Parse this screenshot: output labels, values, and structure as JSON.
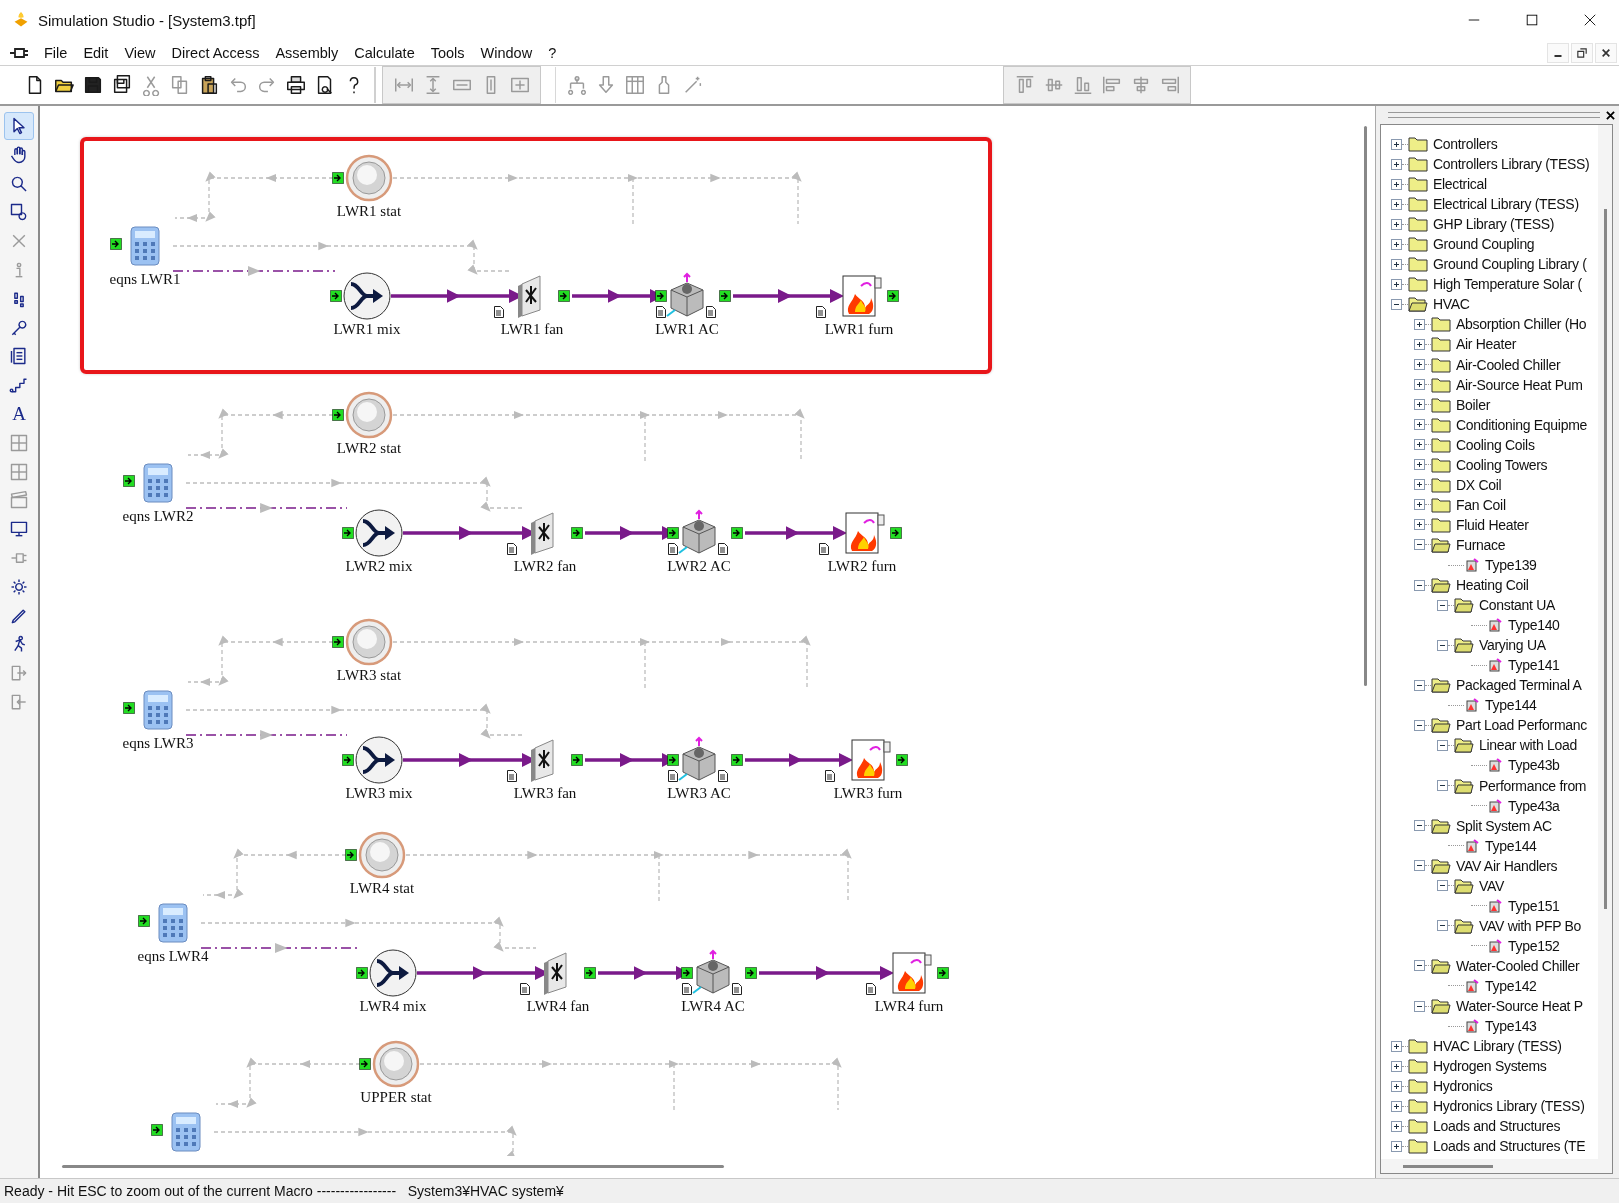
{
  "window": {
    "title": "Simulation Studio - [System3.tpf]"
  },
  "menu": [
    "File",
    "Edit",
    "View",
    "Direct Access",
    "Assembly",
    "Calculate",
    "Tools",
    "Window",
    "?"
  ],
  "toolbar": [
    [
      {
        "kind": "new",
        "disabled": false
      },
      {
        "kind": "open",
        "disabled": false
      },
      {
        "kind": "save",
        "disabled": false
      },
      {
        "kind": "saveall",
        "disabled": false
      },
      {
        "kind": "cut",
        "disabled": true
      },
      {
        "kind": "copy",
        "disabled": true
      },
      {
        "kind": "paste",
        "disabled": false
      },
      {
        "kind": "undo",
        "disabled": true
      },
      {
        "kind": "redo",
        "disabled": true
      },
      {
        "kind": "print",
        "disabled": false
      },
      {
        "kind": "preview",
        "disabled": false
      },
      {
        "kind": "help",
        "disabled": false
      }
    ],
    [
      {
        "kind": "hspace",
        "disabled": true
      },
      {
        "kind": "vspace",
        "disabled": true
      },
      {
        "kind": "hsize",
        "disabled": true
      },
      {
        "kind": "vsize",
        "disabled": true
      },
      {
        "kind": "fit",
        "disabled": true
      }
    ],
    [
      {
        "kind": "tree",
        "disabled": true
      },
      {
        "kind": "down",
        "disabled": true
      },
      {
        "kind": "table",
        "disabled": true
      },
      {
        "kind": "bottle",
        "disabled": true
      },
      {
        "kind": "wand",
        "disabled": true
      }
    ],
    [
      {
        "kind": "atop",
        "disabled": true
      },
      {
        "kind": "amid",
        "disabled": true
      },
      {
        "kind": "abottom",
        "disabled": true
      },
      {
        "kind": "aleft",
        "disabled": true
      },
      {
        "kind": "acenter",
        "disabled": true
      },
      {
        "kind": "aright",
        "disabled": true
      }
    ]
  ],
  "tools": [
    {
      "kind": "pointer",
      "selected": true,
      "disabled": false
    },
    {
      "kind": "hand",
      "selected": false,
      "disabled": false
    },
    {
      "kind": "zoom",
      "selected": false,
      "disabled": false
    },
    {
      "kind": "zoomrect",
      "selected": false,
      "disabled": false
    },
    {
      "kind": "delete",
      "selected": false,
      "disabled": true
    },
    {
      "kind": "info",
      "selected": false,
      "disabled": true
    },
    {
      "kind": "steps",
      "selected": false,
      "disabled": false
    },
    {
      "kind": "key",
      "selected": false,
      "disabled": false
    },
    {
      "kind": "list",
      "selected": false,
      "disabled": false
    },
    {
      "kind": "stairs",
      "selected": false,
      "disabled": false
    },
    {
      "kind": "text",
      "label": "A",
      "selected": false,
      "disabled": false
    },
    {
      "kind": "grid",
      "selected": false,
      "disabled": true
    },
    {
      "kind": "grid",
      "selected": false,
      "disabled": true
    },
    {
      "kind": "clapper",
      "selected": false,
      "disabled": true
    },
    {
      "kind": "monitor",
      "selected": false,
      "disabled": false
    },
    {
      "kind": "plug",
      "selected": false,
      "disabled": true
    },
    {
      "kind": "gear",
      "selected": false,
      "disabled": false
    },
    {
      "kind": "pen",
      "selected": false,
      "disabled": false
    },
    {
      "kind": "runner",
      "selected": false,
      "disabled": false
    },
    {
      "kind": "export",
      "selected": false,
      "disabled": true
    },
    {
      "kind": "import",
      "selected": false,
      "disabled": true
    }
  ],
  "groups": [
    {
      "selected": true,
      "nodes": [
        {
          "kind": "stat",
          "label": "LWR1 stat"
        },
        {
          "kind": "eqns",
          "label": "eqns LWR1"
        },
        {
          "kind": "mix",
          "label": "LWR1 mix"
        },
        {
          "kind": "fan",
          "label": "LWR1 fan"
        },
        {
          "kind": "ac",
          "label": "LWR1 AC"
        },
        {
          "kind": "furn",
          "label": "LWR1 furn"
        }
      ]
    },
    {
      "selected": false,
      "nodes": [
        {
          "kind": "stat",
          "label": "LWR2 stat"
        },
        {
          "kind": "eqns",
          "label": "eqns LWR2"
        },
        {
          "kind": "mix",
          "label": "LWR2 mix"
        },
        {
          "kind": "fan",
          "label": "LWR2 fan"
        },
        {
          "kind": "ac",
          "label": "LWR2 AC"
        },
        {
          "kind": "furn",
          "label": "LWR2 furn"
        }
      ]
    },
    {
      "selected": false,
      "nodes": [
        {
          "kind": "stat",
          "label": "LWR3 stat"
        },
        {
          "kind": "eqns",
          "label": "eqns LWR3"
        },
        {
          "kind": "mix",
          "label": "LWR3 mix"
        },
        {
          "kind": "fan",
          "label": "LWR3 fan"
        },
        {
          "kind": "ac",
          "label": "LWR3 AC"
        },
        {
          "kind": "furn",
          "label": "LWR3 furn"
        }
      ]
    },
    {
      "selected": false,
      "nodes": [
        {
          "kind": "stat",
          "label": "LWR4 stat"
        },
        {
          "kind": "eqns",
          "label": "eqns LWR4"
        },
        {
          "kind": "mix",
          "label": "LWR4 mix"
        },
        {
          "kind": "fan",
          "label": "LWR4 fan"
        },
        {
          "kind": "ac",
          "label": "LWR4 AC"
        },
        {
          "kind": "furn",
          "label": "LWR4 furn"
        }
      ]
    },
    {
      "selected": false,
      "nodes": [
        {
          "kind": "stat",
          "label": "UPPER stat"
        },
        {
          "kind": "eqns"
        }
      ]
    }
  ],
  "tree": {
    "items": [
      {
        "kind": "folder",
        "label": "Controllers",
        "expanded": false
      },
      {
        "kind": "folder",
        "label": "Controllers Library (TESS)",
        "expanded": false
      },
      {
        "kind": "folder",
        "label": "Electrical",
        "expanded": false
      },
      {
        "kind": "folder",
        "label": "Electrical Library (TESS)",
        "expanded": false
      },
      {
        "kind": "folder",
        "label": "GHP Library (TESS)",
        "expanded": false
      },
      {
        "kind": "folder",
        "label": "Ground Coupling",
        "expanded": false
      },
      {
        "kind": "folder",
        "label": "Ground Coupling Library (",
        "expanded": false
      },
      {
        "kind": "folder",
        "label": "High Temperature Solar (",
        "expanded": false
      },
      {
        "kind": "folder",
        "label": "HVAC",
        "expanded": true,
        "children": [
          {
            "kind": "folder",
            "label": "Absorption Chiller (Ho",
            "expanded": false
          },
          {
            "kind": "folder",
            "label": "Air Heater",
            "expanded": false
          },
          {
            "kind": "folder",
            "label": "Air-Cooled Chiller",
            "expanded": false
          },
          {
            "kind": "folder",
            "label": "Air-Source Heat Pum",
            "expanded": false
          },
          {
            "kind": "folder",
            "label": "Boiler",
            "expanded": false
          },
          {
            "kind": "folder",
            "label": "Conditioning Equipme",
            "expanded": false
          },
          {
            "kind": "folder",
            "label": "Cooling Coils",
            "expanded": false
          },
          {
            "kind": "folder",
            "label": "Cooling Towers",
            "expanded": false
          },
          {
            "kind": "folder",
            "label": "DX Coil",
            "expanded": false
          },
          {
            "kind": "folder",
            "label": "Fan Coil",
            "expanded": false
          },
          {
            "kind": "folder",
            "label": "Fluid Heater",
            "expanded": false
          },
          {
            "kind": "folder",
            "label": "Furnace",
            "expanded": true,
            "children": [
              {
                "kind": "component",
                "label": "Type139"
              }
            ]
          },
          {
            "kind": "folder",
            "label": "Heating Coil",
            "expanded": true,
            "children": [
              {
                "kind": "folder",
                "label": "Constant UA",
                "expanded": true,
                "children": [
                  {
                    "kind": "component",
                    "label": "Type140"
                  }
                ]
              },
              {
                "kind": "folder",
                "label": "Varying UA",
                "expanded": true,
                "children": [
                  {
                    "kind": "component",
                    "label": "Type141"
                  }
                ]
              }
            ]
          },
          {
            "kind": "folder",
            "label": "Packaged Terminal A",
            "expanded": true,
            "children": [
              {
                "kind": "component",
                "label": "Type144"
              }
            ]
          },
          {
            "kind": "folder",
            "label": "Part Load Performanc",
            "expanded": true,
            "children": [
              {
                "kind": "folder",
                "label": "Linear with Load",
                "expanded": true,
                "children": [
                  {
                    "kind": "component",
                    "label": "Type43b"
                  }
                ]
              },
              {
                "kind": "folder",
                "label": "Performance from",
                "expanded": true,
                "children": [
                  {
                    "kind": "component",
                    "label": "Type43a"
                  }
                ]
              }
            ]
          },
          {
            "kind": "folder",
            "label": "Split System AC",
            "expanded": true,
            "children": [
              {
                "kind": "component",
                "label": "Type144"
              }
            ]
          },
          {
            "kind": "folder",
            "label": "VAV Air Handlers",
            "expanded": true,
            "children": [
              {
                "kind": "folder",
                "label": "VAV",
                "expanded": true,
                "children": [
                  {
                    "kind": "component",
                    "label": "Type151"
                  }
                ]
              },
              {
                "kind": "folder",
                "label": "VAV with PFP Bo",
                "expanded": true,
                "children": [
                  {
                    "kind": "component",
                    "label": "Type152"
                  }
                ]
              }
            ]
          },
          {
            "kind": "folder",
            "label": "Water-Cooled Chiller",
            "expanded": true,
            "children": [
              {
                "kind": "component",
                "label": "Type142"
              }
            ]
          },
          {
            "kind": "folder",
            "label": "Water-Source Heat P",
            "expanded": true,
            "children": [
              {
                "kind": "component",
                "label": "Type143"
              }
            ]
          }
        ]
      },
      {
        "kind": "folder",
        "label": "HVAC Library (TESS)",
        "expanded": false
      },
      {
        "kind": "folder",
        "label": "Hydrogen Systems",
        "expanded": false
      },
      {
        "kind": "folder",
        "label": "Hydronics",
        "expanded": false
      },
      {
        "kind": "folder",
        "label": "Hydronics Library (TESS)",
        "expanded": false
      },
      {
        "kind": "folder",
        "label": "Loads and Structures",
        "expanded": false
      },
      {
        "kind": "folder",
        "label": "Loads and Structures (TE",
        "expanded": false
      }
    ]
  },
  "status_bar": "Ready - Hit ESC to zoom out of the current Macro -----------------   System3¥HVAC system¥"
}
